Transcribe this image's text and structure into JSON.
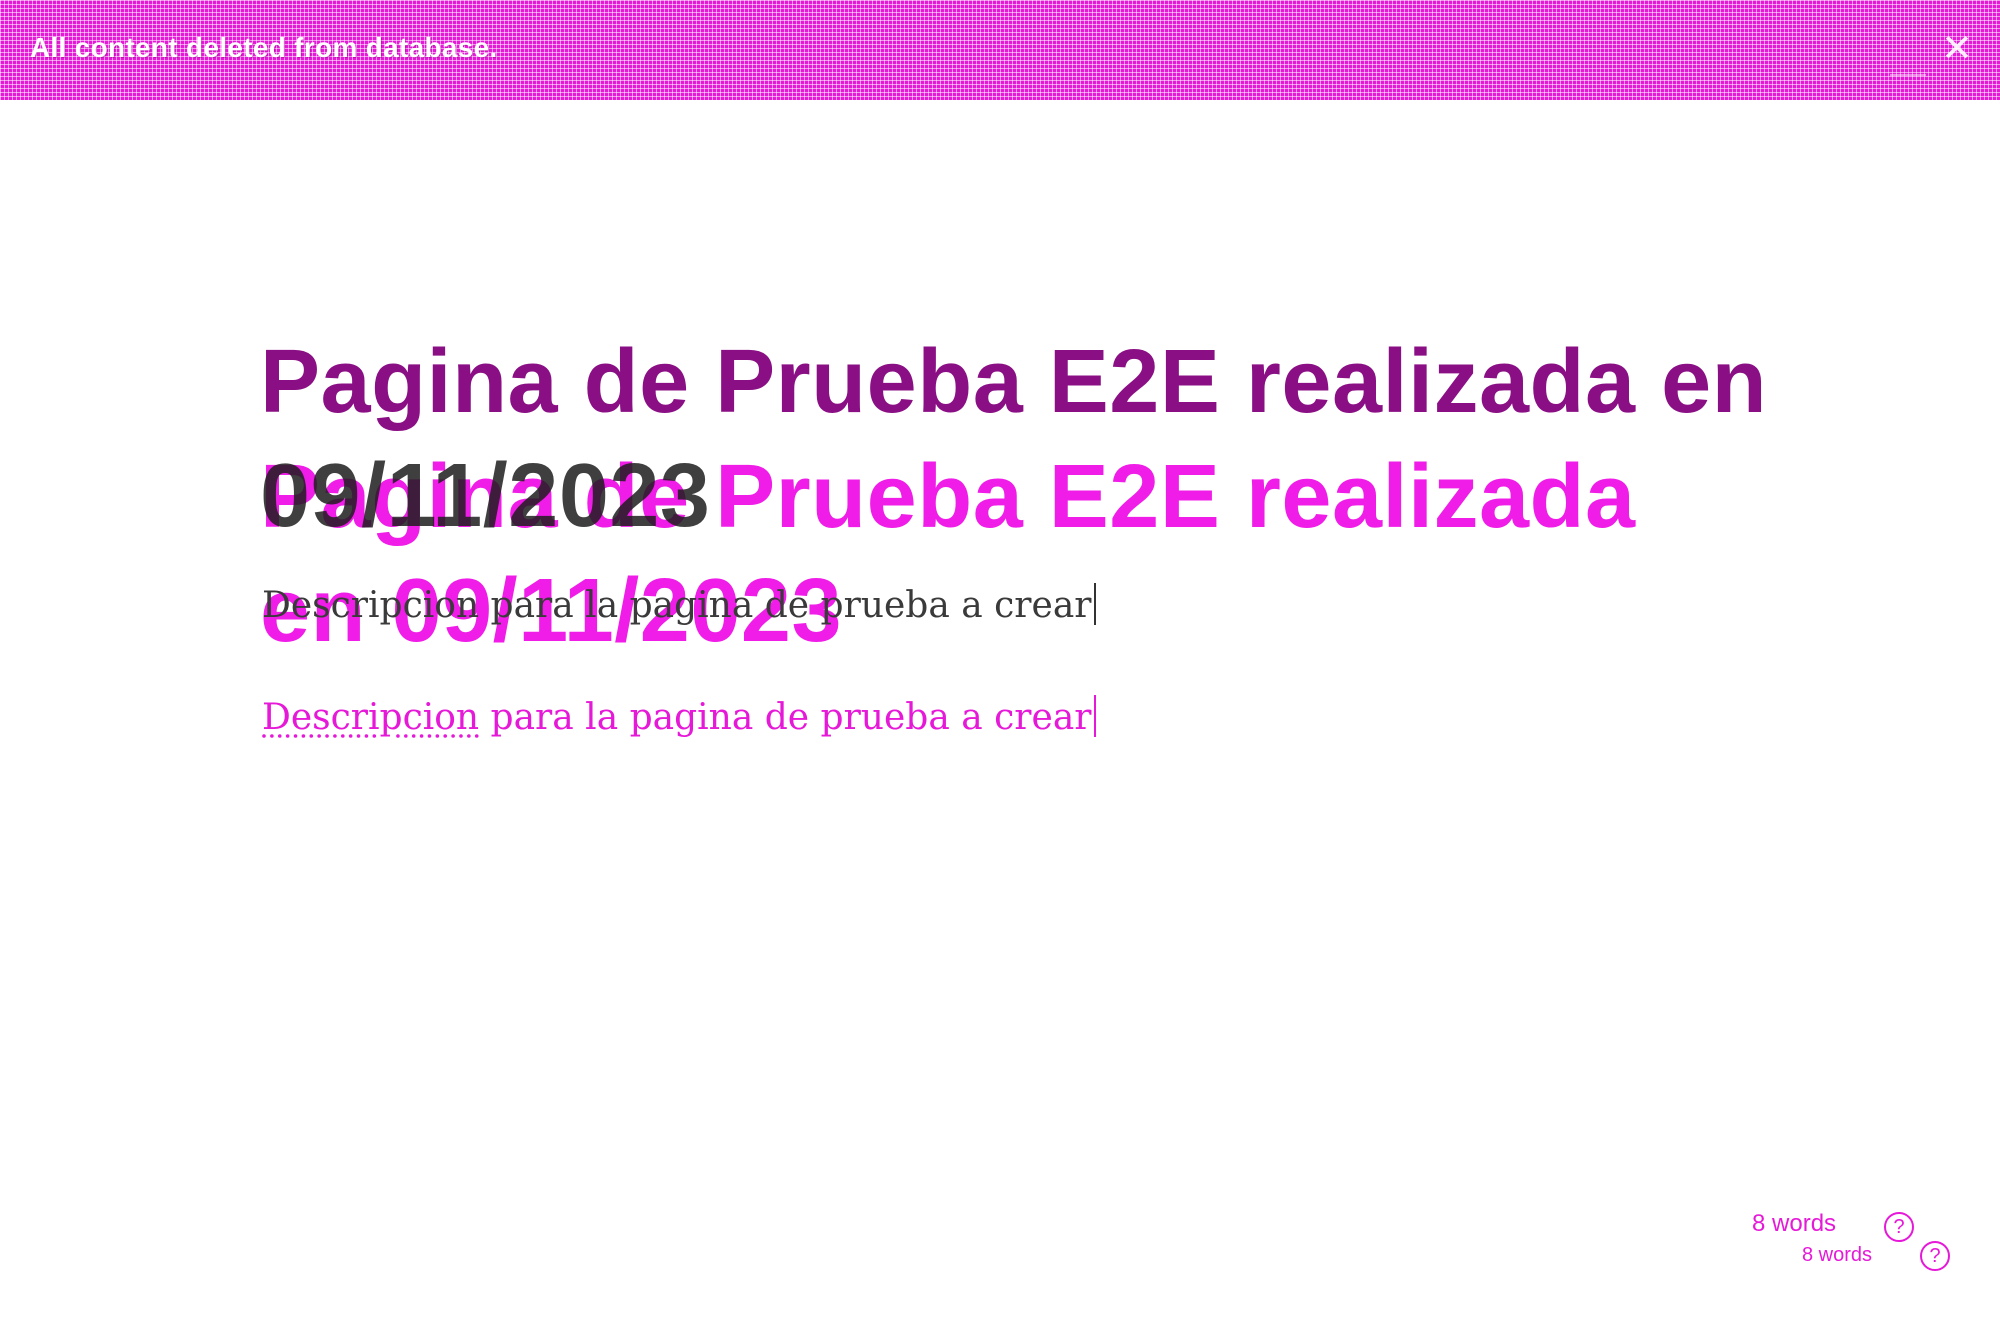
{
  "banner": {
    "message": "All content deleted from database.",
    "ghost_a": "",
    "ghost_b": ""
  },
  "editor": {
    "title": "Pagina de Prueba E2E realizada en 09/11/2023",
    "title_line1": "Pagina de Prueba E2E realizada en",
    "title_date": "09/11/2023",
    "title_ghost": "Pagina de Prueba E2E realizada en 09/11/2023",
    "description": "Descripcion para la pagina de prueba a crear",
    "description_first_word": "Descripcion",
    "description_rest": " para la pagina de prueba a crear"
  },
  "footer": {
    "word_count": "8 words",
    "help_icon": "?"
  },
  "colors": {
    "accent": "#e619d8",
    "title_dark": "#8a0f84",
    "text_dark": "#1e1e1e"
  },
  "icons": {
    "close": "close-icon",
    "help": "help-icon"
  }
}
